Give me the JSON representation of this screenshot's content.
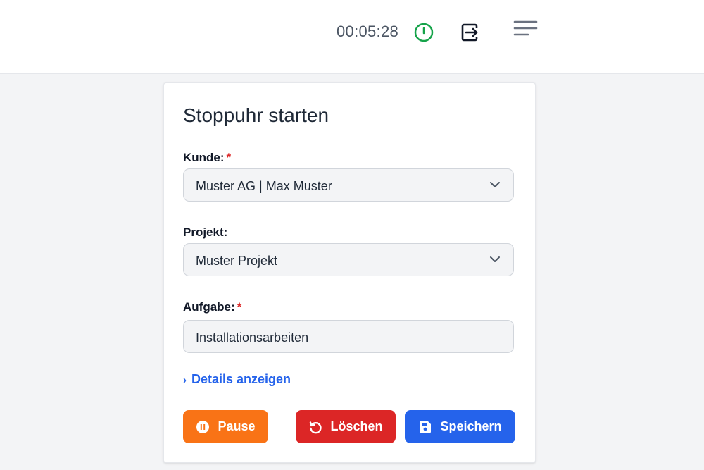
{
  "header": {
    "timer": "00:05:28",
    "icons": {
      "timer": "timer-power-icon",
      "logout": "logout-icon",
      "menu": "menu-icon"
    },
    "timer_icon_color": "#16a34a"
  },
  "form": {
    "title": "Stoppuhr starten",
    "customer": {
      "label": "Kunde:",
      "required": "*",
      "value": "Muster AG | Max Muster"
    },
    "project": {
      "label": "Projekt:",
      "value": "Muster Projekt"
    },
    "task": {
      "label": "Aufgabe:",
      "required": "*",
      "value": "Installationsarbeiten"
    },
    "details_link": "Details anzeigen",
    "buttons": {
      "pause": "Pause",
      "delete": "Löschen",
      "save": "Speichern"
    }
  },
  "colors": {
    "pause": "#f97316",
    "delete": "#dc2626",
    "save": "#2563eb",
    "link": "#2563eb",
    "required": "#dc2626"
  }
}
